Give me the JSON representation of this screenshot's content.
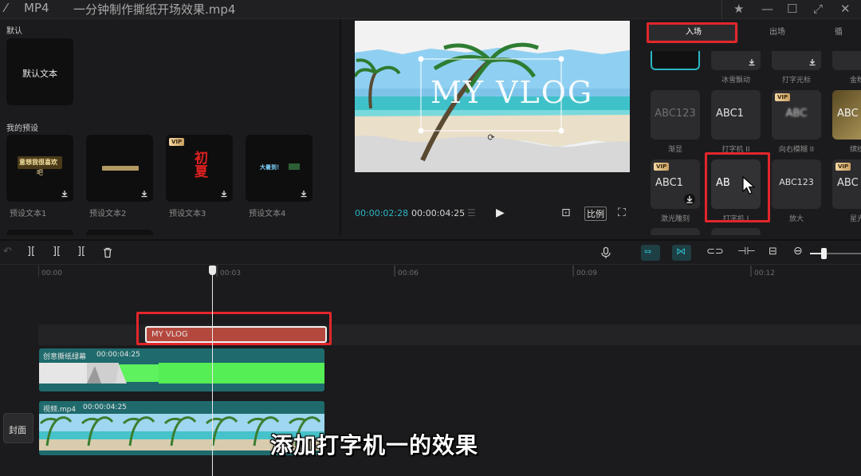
{
  "window": {
    "format": "MP4",
    "title": "一分钟制作撕纸开场效果.mp4"
  },
  "text_panel": {
    "default_label": "默认",
    "default_card": "默认文本",
    "presets_label": "我的预设",
    "presets": [
      {
        "caption": "预设文本1",
        "thumb_text": "意想我很喜欢",
        "vip": false
      },
      {
        "caption": "预设文本2",
        "thumb_text": "",
        "vip": false
      },
      {
        "caption": "预设文本3",
        "thumb_text": "初夏",
        "vip": true
      },
      {
        "caption": "预设文本4",
        "thumb_text": "大暑到！",
        "vip": false
      }
    ],
    "vip_badge": "VIP"
  },
  "player": {
    "overlay_text": "MY VLOG",
    "current_time": "00:00:02:28",
    "total_time": "00:00:04:25",
    "ratio_label": "比例"
  },
  "animation_panel": {
    "tabs": [
      "入场",
      "出场",
      "循"
    ],
    "active_tab": "入场",
    "top_captions": [
      "冰雪飘动",
      "打字光标",
      "金粉"
    ],
    "row1": [
      {
        "label": "ABC123",
        "caption": "渐显",
        "vip": false
      },
      {
        "label": "ABC1",
        "caption": "打字机 II",
        "vip": false
      },
      {
        "label": "ABC",
        "caption": "向右模糊 II",
        "vip": true
      },
      {
        "label": "ABC",
        "caption": "缤纷",
        "vip": false
      }
    ],
    "row2": [
      {
        "label": "ABC1",
        "caption": "激光雕刻",
        "vip": true
      },
      {
        "label": "AB",
        "caption": "打字机 I",
        "vip": false
      },
      {
        "label": "ABC123",
        "caption": "放大",
        "vip": false
      },
      {
        "label": "ABC",
        "caption": "星光",
        "vip": true
      }
    ]
  },
  "timeline": {
    "ticks": [
      "00:00",
      "00:03",
      "00:06",
      "00:09",
      "00:12"
    ],
    "text_clip": "MY VLOG",
    "overlay_clip": {
      "name": "创意撕纸绿幕",
      "duration": "00:00:04:25"
    },
    "video_clip": {
      "name": "视频.mp4",
      "duration": "00:00:04:25"
    },
    "cover_label": "封面"
  },
  "subtitle": "添加打字机一的效果",
  "colors": {
    "accent_red": "#e3262b",
    "timecode_teal": "#2bb6c4",
    "text_clip": "#b5483e",
    "clip_teal": "#1f6a6c"
  }
}
